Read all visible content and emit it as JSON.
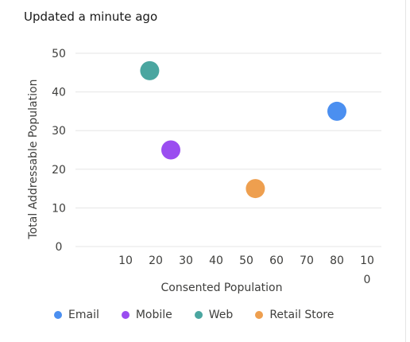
{
  "header": {
    "updated_text": "Updated a minute ago"
  },
  "chart_data": {
    "type": "scatter",
    "xlabel": "Consented Population",
    "ylabel": "Total Addressable Population",
    "xlim": [
      0,
      100
    ],
    "ylim": [
      0,
      50
    ],
    "x_ticks": [
      "10",
      "20",
      "30",
      "40",
      "50",
      "60",
      "70",
      "80",
      "10\n0"
    ],
    "y_ticks": [
      "0",
      "10",
      "20",
      "30",
      "40",
      "50"
    ],
    "grid": true,
    "legend_position": "bottom",
    "series": [
      {
        "name": "Email",
        "color": "#4b8ff0",
        "x": [
          80
        ],
        "y": [
          35
        ]
      },
      {
        "name": "Mobile",
        "color": "#9a4df0",
        "x": [
          25
        ],
        "y": [
          25
        ]
      },
      {
        "name": "Web",
        "color": "#4aa6a0",
        "x": [
          18
        ],
        "y": [
          45.5
        ]
      },
      {
        "name": "Retail Store",
        "color": "#ee9f4f",
        "x": [
          53
        ],
        "y": [
          15
        ]
      }
    ]
  }
}
